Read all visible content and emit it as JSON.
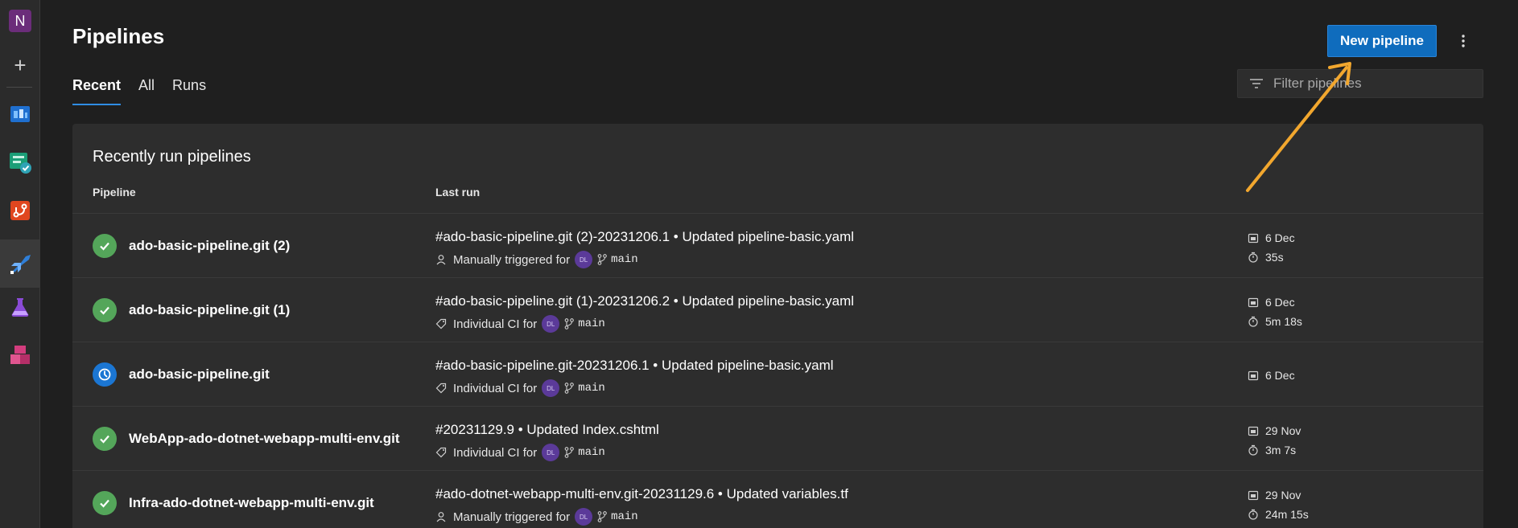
{
  "rail": {
    "org_initial": "N",
    "items": [
      {
        "name": "boards-icon"
      },
      {
        "name": "test-plans-icon"
      },
      {
        "name": "repos-icon"
      },
      {
        "name": "pipelines-icon"
      },
      {
        "name": "test-icon"
      },
      {
        "name": "artifacts-icon"
      }
    ]
  },
  "header": {
    "title": "Pipelines",
    "tabs": [
      {
        "label": "Recent",
        "active": true
      },
      {
        "label": "All",
        "active": false
      },
      {
        "label": "Runs",
        "active": false
      }
    ],
    "new_button": "New pipeline",
    "filter_placeholder": "Filter pipelines"
  },
  "card": {
    "title": "Recently run pipelines",
    "col_pipeline": "Pipeline",
    "col_last_run": "Last run",
    "rows": [
      {
        "status": "succeeded",
        "name": "ado-basic-pipeline.git (2)",
        "run_title": "#ado-basic-pipeline.git (2)-20231206.1 • Updated pipeline-basic.yaml",
        "trigger": "Manually triggered for",
        "trigger_icon": "person-icon",
        "avatar": "DL",
        "branch": "main",
        "date": "6 Dec",
        "duration": "35s"
      },
      {
        "status": "succeeded",
        "name": "ado-basic-pipeline.git (1)",
        "run_title": "#ado-basic-pipeline.git (1)-20231206.2 • Updated pipeline-basic.yaml",
        "trigger": "Individual CI for",
        "trigger_icon": "tag-icon",
        "avatar": "DL",
        "branch": "main",
        "date": "6 Dec",
        "duration": "5m 18s"
      },
      {
        "status": "running",
        "name": "ado-basic-pipeline.git",
        "run_title": "#ado-basic-pipeline.git-20231206.1 • Updated pipeline-basic.yaml",
        "trigger": "Individual CI for",
        "trigger_icon": "tag-icon",
        "avatar": "DL",
        "branch": "main",
        "date": "6 Dec",
        "duration": ""
      },
      {
        "status": "succeeded",
        "name": "WebApp-ado-dotnet-webapp-multi-env.git",
        "run_title": "#20231129.9 • Updated Index.cshtml",
        "trigger": "Individual CI for",
        "trigger_icon": "tag-icon",
        "avatar": "DL",
        "branch": "main",
        "date": "29 Nov",
        "duration": "3m 7s"
      },
      {
        "status": "succeeded",
        "name": "Infra-ado-dotnet-webapp-multi-env.git",
        "run_title": "#ado-dotnet-webapp-multi-env.git-20231129.6 • Updated variables.tf",
        "trigger": "Manually triggered for",
        "trigger_icon": "person-icon",
        "avatar": "DL",
        "branch": "main",
        "date": "29 Nov",
        "duration": "24m 15s"
      }
    ]
  },
  "colors": {
    "accent": "#0f6cbd",
    "success": "#54a65a",
    "running": "#1b76d3",
    "annotation_arrow": "#f2a72e"
  }
}
